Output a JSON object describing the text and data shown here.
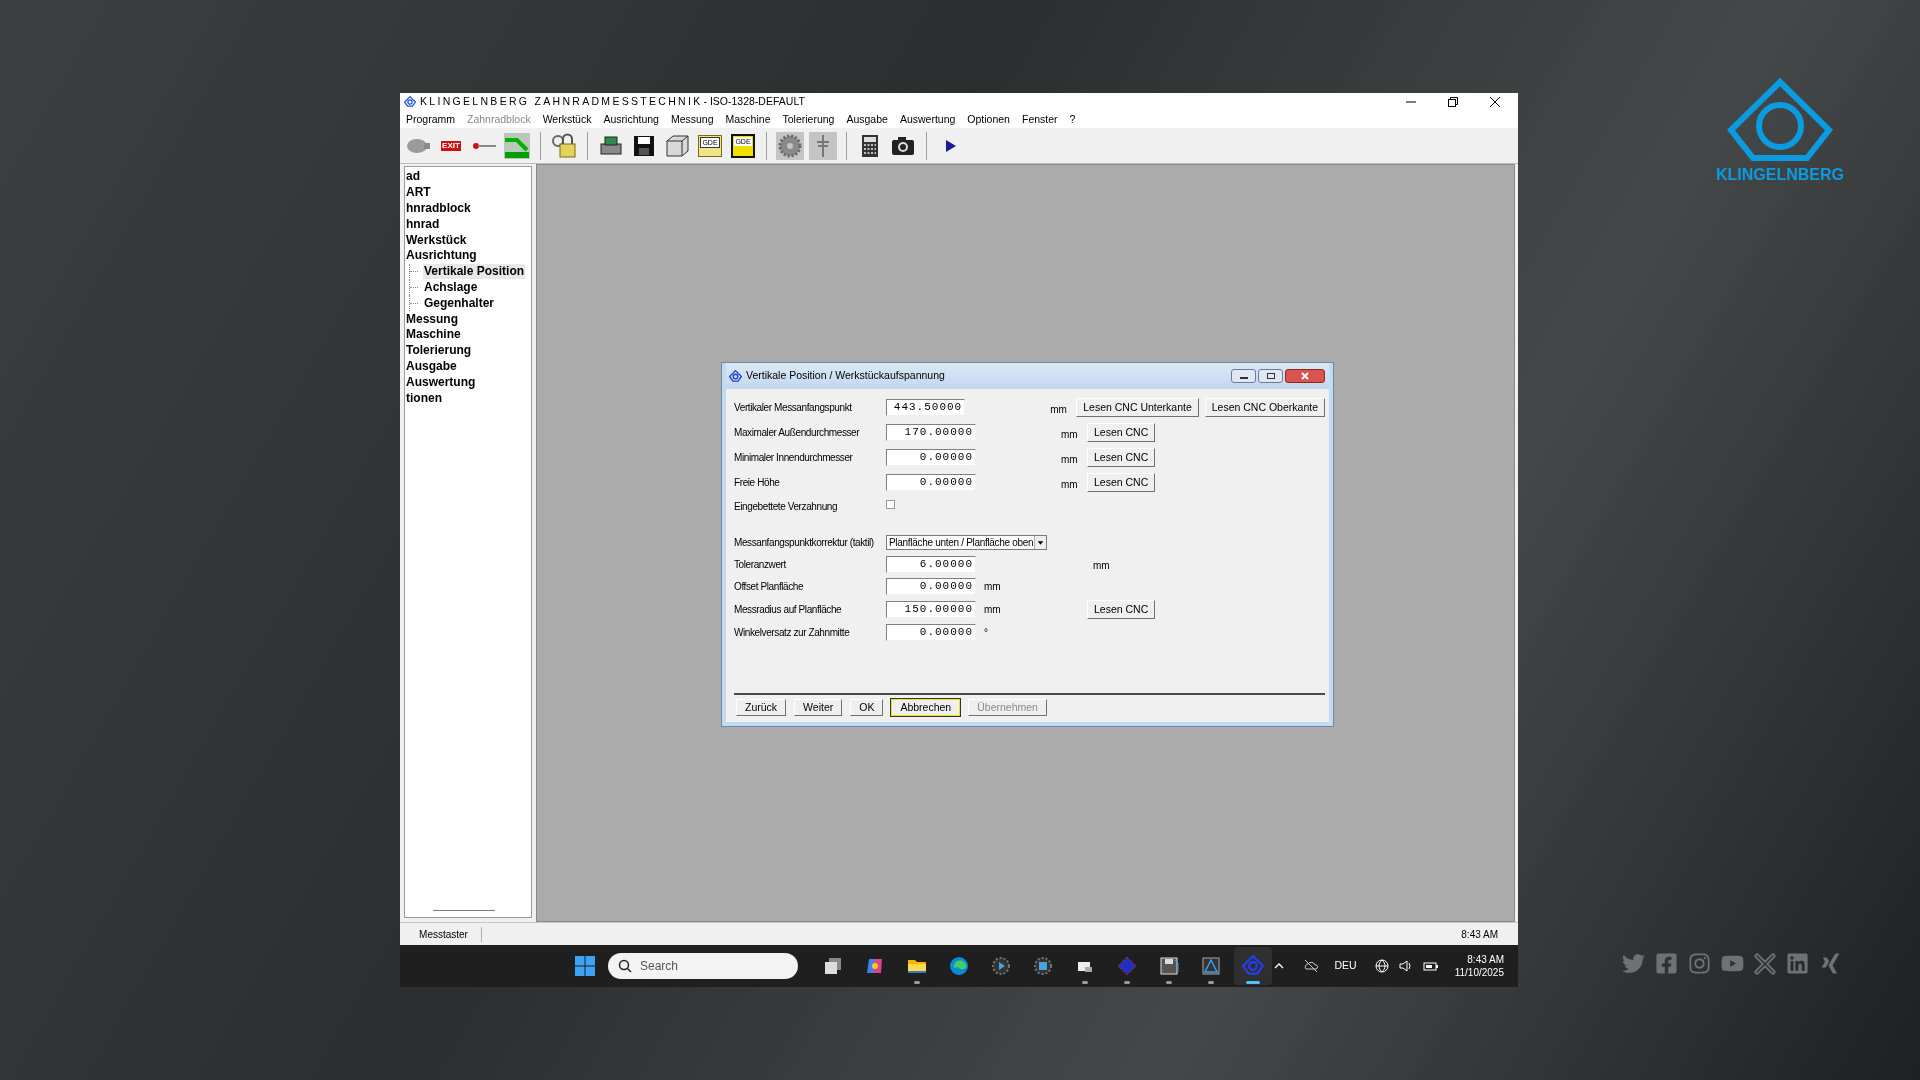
{
  "window": {
    "title_brand": "KLINGELNBERG ZAHNRADMESSTECHNIK",
    "title_rest": "- ISO-1328-DEFAULT"
  },
  "menu": [
    {
      "label": "Programm",
      "disabled": false
    },
    {
      "label": "Zahnradblock",
      "disabled": true
    },
    {
      "label": "Werkstück",
      "disabled": false
    },
    {
      "label": "Ausrichtung",
      "disabled": false
    },
    {
      "label": "Messung",
      "disabled": false
    },
    {
      "label": "Maschine",
      "disabled": false
    },
    {
      "label": "Tolerierung",
      "disabled": false
    },
    {
      "label": "Ausgabe",
      "disabled": false
    },
    {
      "label": "Auswertung",
      "disabled": false
    },
    {
      "label": "Optionen",
      "disabled": false
    },
    {
      "label": "Fenster",
      "disabled": false
    },
    {
      "label": "?",
      "disabled": false
    }
  ],
  "toolbar": [
    {
      "kind": "blob"
    },
    {
      "kind": "exit",
      "label": "EXIT"
    },
    {
      "kind": "probe"
    },
    {
      "kind": "green"
    },
    {
      "kind": "separator"
    },
    {
      "kind": "lock"
    },
    {
      "kind": "separator"
    },
    {
      "kind": "printer"
    },
    {
      "kind": "save"
    },
    {
      "kind": "box"
    },
    {
      "kind": "folder",
      "label": "GDE"
    },
    {
      "kind": "disk",
      "label": "GDE"
    },
    {
      "kind": "separator"
    },
    {
      "kind": "gear"
    },
    {
      "kind": "tool"
    },
    {
      "kind": "separator"
    },
    {
      "kind": "calculator"
    },
    {
      "kind": "camera"
    },
    {
      "kind": "separator"
    },
    {
      "kind": "play"
    }
  ],
  "tree": [
    {
      "label": "ad",
      "selected": false
    },
    {
      "label": "ART",
      "selected": false
    },
    {
      "label": "hnradblock",
      "selected": false
    },
    {
      "label": "hnrad",
      "selected": false
    },
    {
      "label": "Werkstück",
      "selected": false
    },
    {
      "label": "Ausrichtung",
      "selected": false,
      "children": [
        {
          "label": "Vertikale Position",
          "selected": true
        },
        {
          "label": "Achslage",
          "selected": false
        },
        {
          "label": "Gegenhalter",
          "selected": false
        }
      ]
    },
    {
      "label": "Messung",
      "selected": false
    },
    {
      "label": "Maschine",
      "selected": false
    },
    {
      "label": "Tolerierung",
      "selected": false
    },
    {
      "label": "Ausgabe",
      "selected": false
    },
    {
      "label": "Auswertung",
      "selected": false
    },
    {
      "label": "tionen",
      "selected": false
    }
  ],
  "dialog": {
    "title": "Vertikale Position / Werkstückaufspannung",
    "rows": [
      {
        "kind": "column",
        "label": "Vertikaler Messanfangspunkt",
        "value": "443.50000",
        "unit": "mm",
        "buttons": [
          "Lesen CNC Unterkante",
          "Lesen CNC Oberkante"
        ]
      },
      {
        "kind": "column",
        "label": "Maximaler Außendurchmesser",
        "value": "170.00000",
        "unit": "mm",
        "buttons": [
          "Lesen CNC"
        ]
      },
      {
        "kind": "column",
        "label": "Minimaler Innendurchmesser",
        "value": "0.00000",
        "unit": "mm",
        "buttons": [
          "Lesen CNC"
        ]
      },
      {
        "kind": "column",
        "label": "Freie Höhe",
        "value": "0.00000",
        "unit": "mm",
        "buttons": [
          "Lesen CNC"
        ]
      },
      {
        "kind": "checkbox",
        "label": "Eingebettete Verzahnung",
        "checked": false
      },
      {
        "kind": "dropdown",
        "label": "Messanfangspunktkorrektur (taktil)",
        "value": "Planfläche unten / Planfläche oben"
      },
      {
        "kind": "right",
        "label": "Toleranzwert",
        "value": "6.00000",
        "unit": "mm"
      },
      {
        "kind": "inline",
        "label": "Offset Planfläche",
        "value": "0.00000",
        "unit": "mm"
      },
      {
        "kind": "inline",
        "label": "Messradius auf Planfläche",
        "value": "150.00000",
        "unit": "mm",
        "buttons": [
          "Lesen CNC"
        ]
      },
      {
        "kind": "inline",
        "label": "Winkelversatz zur Zahnmitte",
        "value": "0.00000",
        "unit": "°"
      }
    ],
    "buttons": [
      {
        "label": "Zurück",
        "focused": false,
        "disabled": false
      },
      {
        "label": "Weiter",
        "focused": false,
        "disabled": false
      },
      {
        "label": "OK",
        "focused": false,
        "disabled": false
      },
      {
        "label": "Abbrechen",
        "focused": true,
        "disabled": false
      },
      {
        "label": "Übernehmen",
        "focused": false,
        "disabled": true
      }
    ]
  },
  "status_bar": {
    "panel": "Messtaster",
    "time": "8:43 AM"
  },
  "taskbar": {
    "search": {
      "placeholder": "Search"
    },
    "apps": [
      {
        "kind": "taskview",
        "running": false,
        "selected": false
      },
      {
        "kind": "copilot",
        "running": false,
        "selected": false
      },
      {
        "kind": "folder",
        "running": true,
        "selected": false
      },
      {
        "kind": "edge",
        "running": false,
        "selected": false
      },
      {
        "kind": "media",
        "running": false,
        "selected": false
      },
      {
        "kind": "square",
        "running": false,
        "selected": false
      },
      {
        "kind": "files",
        "running": true,
        "selected": false
      },
      {
        "kind": "diamond",
        "running": true,
        "selected": false
      },
      {
        "kind": "disk",
        "running": true,
        "selected": false
      },
      {
        "kind": "triangle",
        "running": true,
        "selected": false
      },
      {
        "kind": "logo",
        "running": true,
        "selected": true
      }
    ],
    "language": "DEU",
    "time": "8:43 AM",
    "date": "11/10/2025"
  },
  "brand": {
    "name": "KLINGELNBERG"
  },
  "social": [
    {
      "kind": "twitter"
    },
    {
      "kind": "facebook"
    },
    {
      "kind": "instagram"
    },
    {
      "kind": "youtube"
    },
    {
      "kind": "cross"
    },
    {
      "kind": "linkedin"
    },
    {
      "kind": "xing"
    }
  ]
}
